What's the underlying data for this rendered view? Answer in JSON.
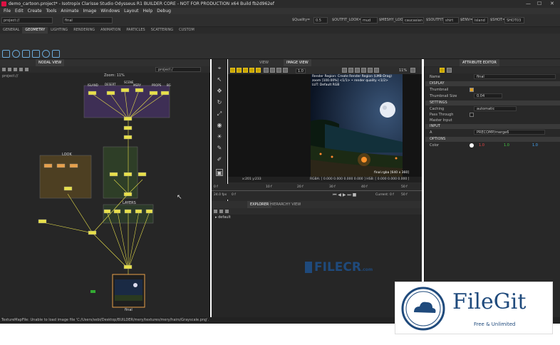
{
  "window": {
    "title": "demo_cartoon.project* - Isotropix Clarisse Studio Odysseus R1 BUILDER CORE - NOT FOR PRODUCTION x64 Build fb2d962ef",
    "controls": [
      "—",
      "☐",
      "✕"
    ]
  },
  "menu": [
    "File",
    "Edit",
    "Create",
    "Tools",
    "Animate",
    "Image",
    "Windows",
    "Layout",
    "Help",
    "Debug"
  ],
  "toolbar": {
    "context_path": "project://",
    "context_field": "final",
    "quality_label": "$Quality=",
    "quality_value": "0.5",
    "outfit_label": "$OUTFIT_LOOK=",
    "outfit_value": "mud",
    "meshy_label": "$MESHY_LOOK=",
    "meshy_value": "caucasian",
    "soutfit_label": "$SOUTFIT=",
    "soutfit_value": "shirt",
    "senv_label": "$ENV=",
    "senv_value": "island",
    "sshot_label": "$SHOT=",
    "sshot_value": "SHOT03"
  },
  "tabs": [
    "GENERAL",
    "GEOMETRY",
    "LIGHTING",
    "RENDERING",
    "ANIMATION",
    "PARTICLES",
    "SCATTERING",
    "CUSTOM"
  ],
  "active_tab": "GEOMETRY",
  "node_view": {
    "tab_label": "NODAL VIEW",
    "breadcrumb": "project://",
    "path_label": "project:/",
    "zoom_label": "Zoom: 11%",
    "groups": [
      "ISLAND",
      "DESERT",
      "SCENE",
      "MERY",
      "PROPS",
      "BG"
    ],
    "look_label": "LOOK",
    "layers_label": "LAYERS",
    "final_label": "final"
  },
  "image_view": {
    "tabs": [
      "VIEW",
      "IMAGE VIEW"
    ],
    "zoom": "11%",
    "frame_field": "1.0",
    "overlay_lines": [
      "Render Region: Create Render Region (LMB-Drag)",
      "zoom [100.00%] <1/1> • render quality <1/2>",
      "LUT: Default RGB"
    ],
    "image_info": "final.rgba [640 x 360]",
    "pixel_readout": "RGBA: [ 0.000 0.000 0.000 0.000 ] HSB: [ 0.000 0.000 0.000 ]",
    "coord_readout": "x:201 y:233"
  },
  "timeline": {
    "ticks": [
      "0 f",
      "10 f",
      "20 f",
      "30 f",
      "40 f",
      "50 f"
    ],
    "start_frame": "0 f",
    "fps": "24.0 fps",
    "end_frame": "50 f",
    "current_frame": "0 f",
    "current_label": "Current:",
    "end_label": "50 f"
  },
  "explorer": {
    "tabs": [
      "EXPLORER",
      "HIERARCHY VIEW"
    ],
    "items": [
      "default"
    ]
  },
  "attribute_editor": {
    "tab_label": "ATTRIBUTE EDITOR",
    "name_label": "Name",
    "name_value": "final",
    "sections": {
      "display": "DISPLAY",
      "settings": "SETTINGS",
      "input": "INPUT",
      "options": "OPTIONS"
    },
    "rows": {
      "thumbnail": "Thumbnail",
      "thumbnail_size": "Thumbnail Size",
      "thumbnail_size_value": "0.04",
      "caching": "Caching",
      "caching_value": "automatic",
      "pass_through": "Pass Through",
      "master_input": "Master Input",
      "input_a": "A",
      "input_a_value": "PRECOMP/merge6",
      "color": "Color",
      "color_values": [
        "1.0",
        "1.0",
        "1.0"
      ]
    }
  },
  "status_message": "TextureMapFile: Unable to load image file 'C:/Users/sebi/Desktop/BUILDER/mery/textures/mery/hairs/Grayscale.png'.",
  "watermarks": {
    "filecr": "FILECR",
    "filecr_sub": ".com",
    "filegit": "FileGit",
    "filegit_tag": "Free & Unlimited"
  },
  "colors": {
    "accent_yellow": "#e8e04a",
    "look_box": "#5a4a2a",
    "scene_box": "#4a3860",
    "layers_box": "#2f4a2a",
    "filegit_blue": "#1f4a7c"
  }
}
